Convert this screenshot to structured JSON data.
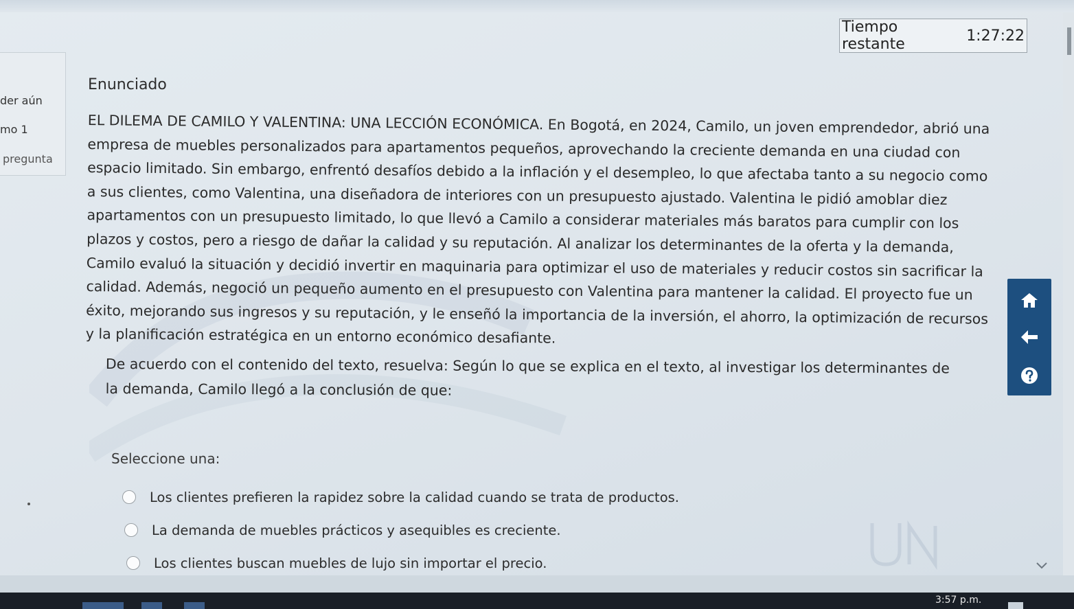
{
  "timer": {
    "label": "Tiempo restante",
    "value": "1:27:22"
  },
  "left_panel": {
    "line1": "der aún",
    "line2": "mo 1",
    "line3": "pregunta"
  },
  "question": {
    "heading": "Enunciado",
    "statement": "EL DILEMA DE CAMILO Y VALENTINA: UNA LECCIÓN ECONÓMICA. En Bogotá, en 2024, Camilo, un joven emprendedor, abrió una empresa de muebles personalizados para apartamentos pequeños, aprovechando la creciente demanda en una ciudad con espacio limitado. Sin embargo, enfrentó desafíos debido a la inflación y el desempleo, lo que afectaba tanto a su negocio como a sus clientes, como Valentina, una diseñadora de interiores con un presupuesto ajustado. Valentina le pidió amoblar diez apartamentos con un presupuesto limitado, lo que llevó a Camilo a considerar materiales más baratos para cumplir con los plazos y costos, pero a riesgo de dañar la calidad y su reputación. Al analizar los determinantes de la oferta y la demanda, Camilo evaluó la situación y decidió invertir en maquinaria para optimizar el uso de materiales y reducir costos sin sacrificar la calidad. Además, negoció un pequeño aumento en el presupuesto con Valentina para mantener la calidad. El proyecto fue un éxito, mejorando sus ingresos y su reputación, y le enseñó la importancia de la inversión, el ahorro, la optimización de recursos y la planificación estratégica en un entorno económico desafiante.",
    "prompt": "De acuerdo con el contenido del texto, resuelva: Según lo que se explica en el texto, al investigar los determinantes de la demanda, Camilo llegó a la conclusión de que:",
    "select_label": "Seleccione una:",
    "options": [
      "Los clientes prefieren la rapidez sobre la calidad cuando se trata de productos.",
      "La demanda de muebles prácticos y asequibles es creciente.",
      "Los clientes buscan muebles de lujo sin importar el precio."
    ]
  },
  "side_nav": {
    "icons": [
      "home-icon",
      "arrow-left-icon",
      "help-icon"
    ],
    "color": "#1d4f7f"
  },
  "taskbar": {
    "clock": "3:57 p.m."
  }
}
